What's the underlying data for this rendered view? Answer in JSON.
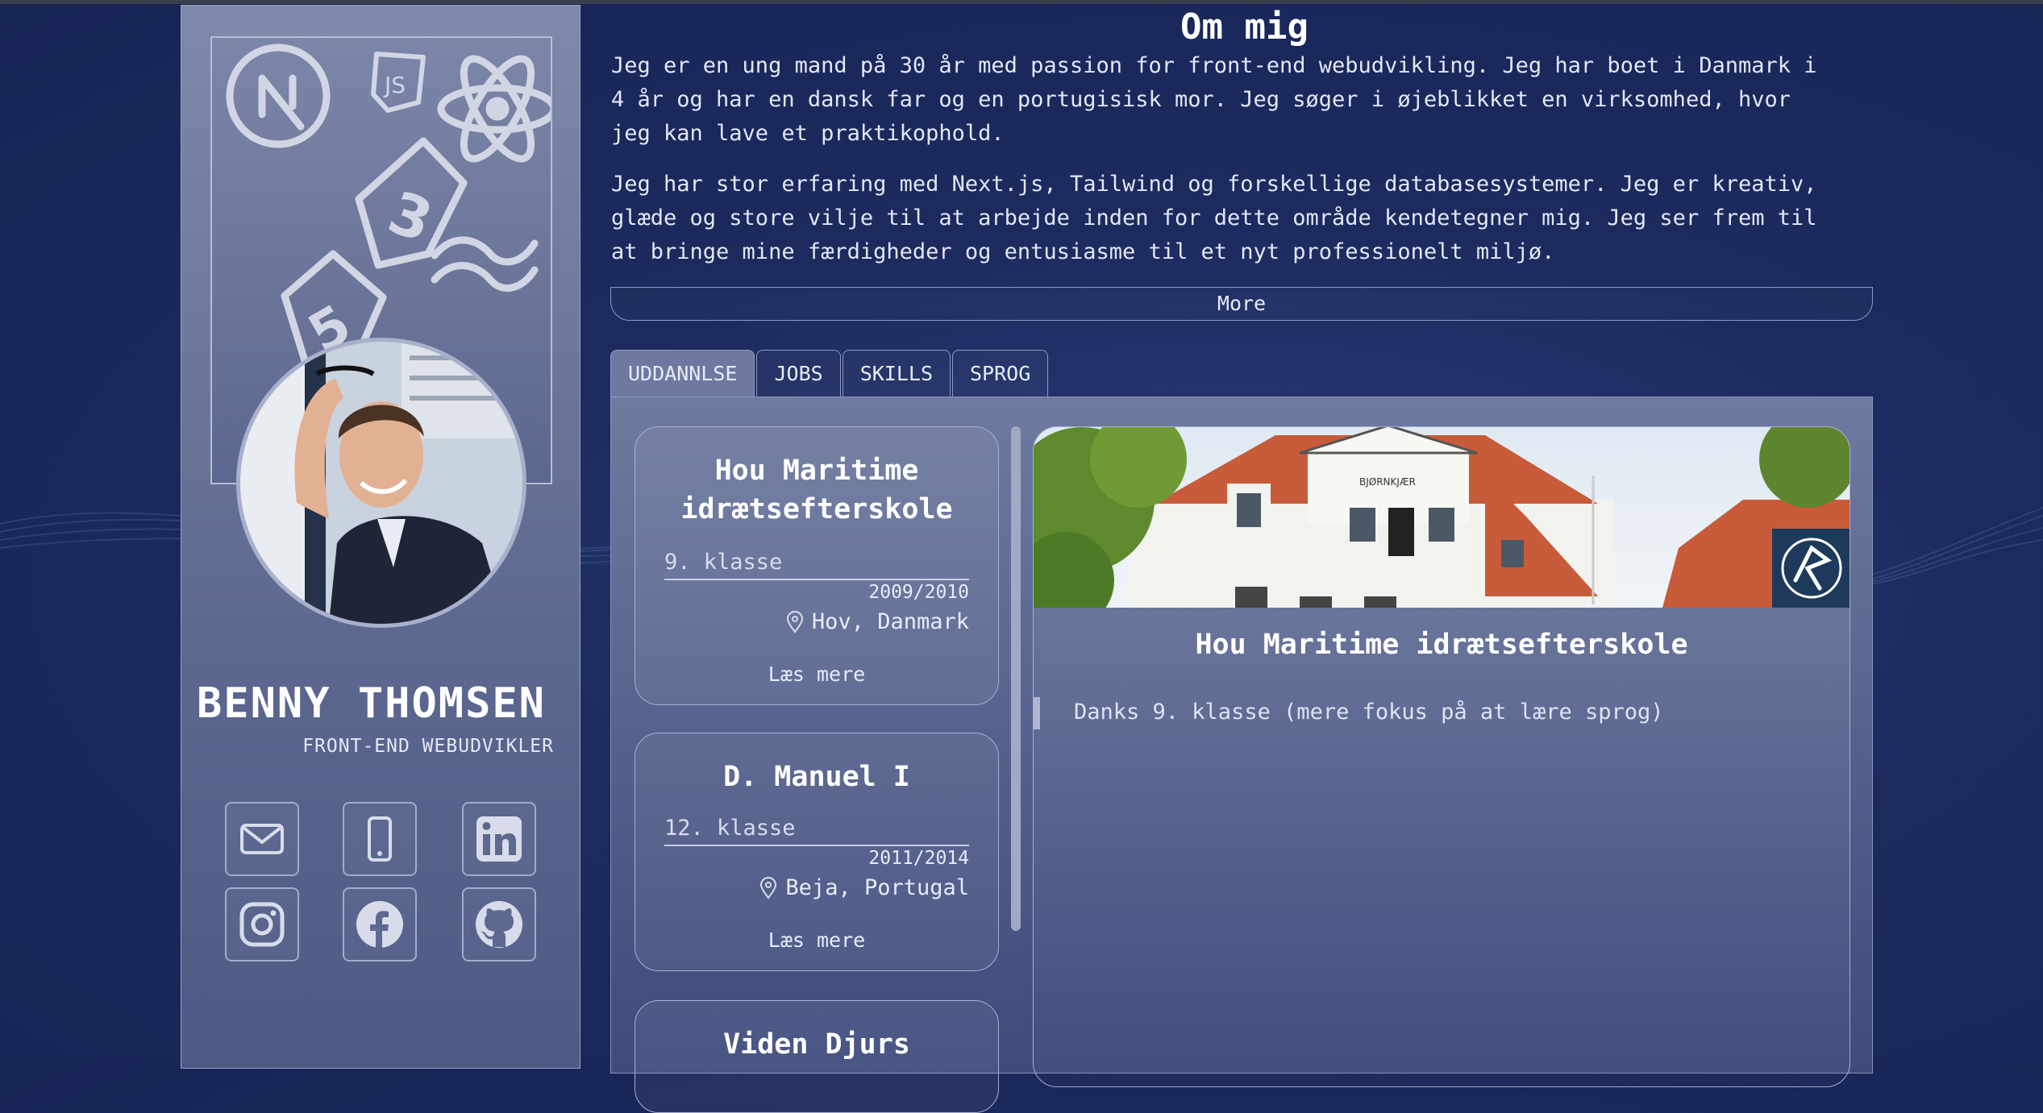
{
  "profile": {
    "name": "BENNY THOMSEN",
    "role": "FRONT-END WEBUDVIKLER"
  },
  "social_icons": [
    "mail-icon",
    "phone-icon",
    "linkedin-icon",
    "instagram-icon",
    "facebook-icon",
    "github-icon"
  ],
  "about": {
    "title": "Om mig",
    "paragraph1_lines": [
      "Jeg er en ung mand på 30 år med passion for front-end webudvikling. Jeg har boet i Danmark i",
      "4 år og har en dansk far og en portugisisk mor. Jeg søger i øjeblikket en virksomhed, hvor",
      "jeg kan lave et praktikophold."
    ],
    "paragraph2_lines": [
      "Jeg har stor erfaring med Next.js, Tailwind og forskellige databasesystemer. Jeg er kreativ,",
      "glæde og store vilje til at arbejde inden for dette område kendetegner mig. Jeg ser frem til",
      "at bringe mine færdigheder og entusiasme til et nyt professionelt miljø."
    ],
    "more_label": "More"
  },
  "tabs": [
    {
      "label": "UDDANNLSE",
      "active": true
    },
    {
      "label": "JOBS",
      "active": false
    },
    {
      "label": "SKILLS",
      "active": false
    },
    {
      "label": "SPROG",
      "active": false
    }
  ],
  "education": [
    {
      "title_lines": [
        "Hou Maritime",
        "idrætsefterskole"
      ],
      "grade": "9. klasse",
      "years": "2009/2010",
      "location": "Hov, Danmark",
      "more": "Læs mere"
    },
    {
      "title_lines": [
        "D. Manuel I"
      ],
      "grade": "12. klasse",
      "years": "2011/2014",
      "location": "Beja, Portugal",
      "more": "Læs mere"
    },
    {
      "title_lines": [
        "Viden Djurs"
      ]
    }
  ],
  "detail": {
    "title": "Hou Maritime idrætsefterskole",
    "description": "Danks 9. klasse (mere fokus på at lære sprog)"
  },
  "colors": {
    "background": "#1c2a5e",
    "sidebar": "#6c7698",
    "panel": "#5e6a93",
    "roof": "#c75b3a"
  }
}
